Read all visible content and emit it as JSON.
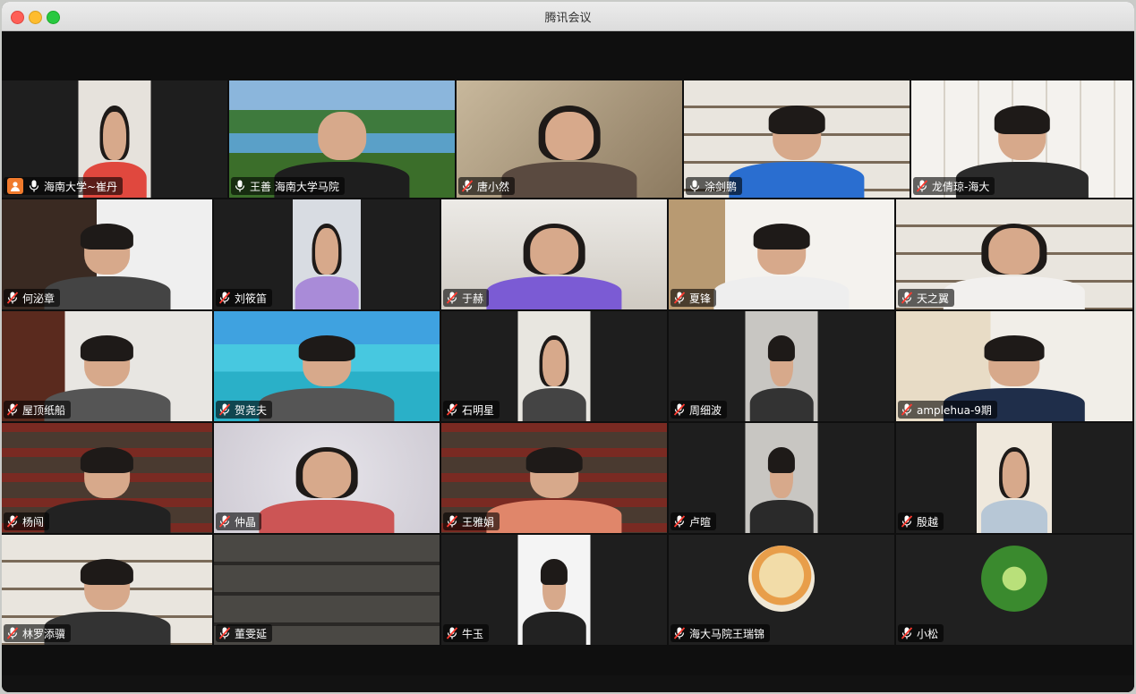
{
  "window": {
    "title": "腾讯会议"
  },
  "participants": [
    {
      "name": "海南大学~崔丹",
      "mic": "on",
      "active": true,
      "scene": "office",
      "hair": "long",
      "shirt": "#e0483e"
    },
    {
      "name": "王善 海南大学马院",
      "mic": "on",
      "scene": "lake",
      "hair": "bald",
      "shirt": "#1e1e1e"
    },
    {
      "name": "唐小然",
      "mic": "muted",
      "scene": "beige",
      "hair": "long",
      "shirt": "#5a4a40"
    },
    {
      "name": "涂剑鹏",
      "mic": "on",
      "scene": "shelf",
      "hair": "short",
      "shirt": "#2a6ed0"
    },
    {
      "name": "龙倩琼-海大",
      "mic": "muted",
      "scene": "white-shelf",
      "hair": "short",
      "shirt": "#2b2b2b"
    },
    {
      "name": "何泌章",
      "mic": "muted",
      "scene": "dark-shelf",
      "hair": "short",
      "shirt": "#444"
    },
    {
      "name": "刘筱笛",
      "mic": "muted",
      "scene": "wall",
      "hair": "long",
      "shirt": "#a98bd8"
    },
    {
      "name": "于赫",
      "mic": "muted",
      "scene": "bright-office",
      "hair": "long",
      "shirt": "#7b5bd4"
    },
    {
      "name": "夏锋",
      "mic": "muted",
      "scene": "calligraphy",
      "hair": "short",
      "shirt": "#eeeeee"
    },
    {
      "name": "天之翼",
      "mic": "muted",
      "scene": "shelf",
      "hair": "long",
      "shirt": "#f2f0ee"
    },
    {
      "name": "屋顶纸船",
      "mic": "muted",
      "scene": "wood",
      "hair": "short",
      "shirt": "#555"
    },
    {
      "name": "贺尧夫",
      "mic": "muted",
      "scene": "sea",
      "hair": "short",
      "shirt": "#555"
    },
    {
      "name": "石明星",
      "mic": "muted",
      "scene": "narrow",
      "hair": "long",
      "shirt": "#444"
    },
    {
      "name": "周细波",
      "mic": "muted",
      "scene": "narrow-gray",
      "hair": "short",
      "shirt": "#333"
    },
    {
      "name": "amplehua-9期",
      "mic": "muted",
      "scene": "whiteboard",
      "hair": "short",
      "shirt": "#1f2e4a"
    },
    {
      "name": "杨闯",
      "mic": "muted",
      "scene": "bookcase",
      "hair": "short",
      "shirt": "#222"
    },
    {
      "name": "仲晶",
      "mic": "muted",
      "scene": "wallpaper",
      "hair": "long",
      "shirt": "#c55"
    },
    {
      "name": "王雅娟",
      "mic": "muted",
      "scene": "bookcase",
      "hair": "short",
      "shirt": "#e0866a"
    },
    {
      "name": "卢暄",
      "mic": "muted",
      "scene": "narrow-gray",
      "hair": "short",
      "shirt": "#2a2a2a"
    },
    {
      "name": "殷越",
      "mic": "muted",
      "scene": "narrow-warm",
      "hair": "long",
      "shirt": "#b7c7d6"
    },
    {
      "name": "林罗添骥",
      "mic": "muted",
      "scene": "shelf",
      "hair": "short",
      "shirt": "#333"
    },
    {
      "name": "董雯延",
      "mic": "muted",
      "scene": "dark-shelf2",
      "hair": "none",
      "shirt": "#333"
    },
    {
      "name": "牛玉",
      "mic": "muted",
      "scene": "narrow-white",
      "hair": "short",
      "shirt": "#222"
    },
    {
      "name": "海大马院王瑞锦",
      "mic": "muted",
      "scene": "avatar-giraffe",
      "hair": "none",
      "shirt": "#000"
    },
    {
      "name": "小松",
      "mic": "muted",
      "scene": "avatar-forest",
      "hair": "none",
      "shirt": "#000"
    }
  ]
}
